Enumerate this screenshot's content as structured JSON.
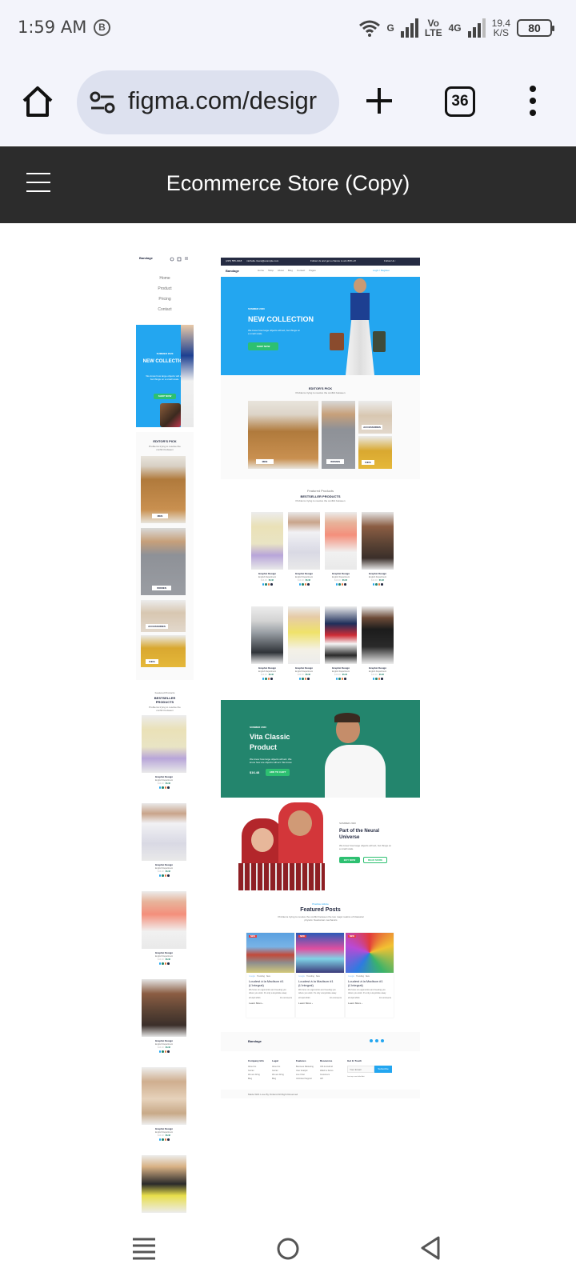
{
  "status": {
    "time": "1:59 AM",
    "b_icon": "B",
    "g_label": "G",
    "volte_top": "Vo",
    "volte_bottom": "LTE",
    "net_4g": "4G",
    "speed_value": "19.4",
    "speed_unit": "K/S",
    "battery": "80"
  },
  "browser": {
    "url": "figma.com/desigr",
    "tab_count": "36"
  },
  "figma": {
    "title": "Ecommerce Store (Copy)"
  },
  "mobile_frame": {
    "brand": "Bandage",
    "nav": [
      "Home",
      "Product",
      "Pricing",
      "Contact"
    ],
    "hero_tag": "SUMMER 2020",
    "hero_title": "NEW COLLECTION",
    "hero_text": "We know how large objects will act, but things on a small scale.",
    "hero_button": "SHOP NOW",
    "editors_pick": "EDITOR'S PICK",
    "editors_sub": "Problems trying to resolve the conflict between",
    "pick_labels": [
      "MEN",
      "WOMEN",
      "ACCESSORIES",
      "KIDS"
    ],
    "featured_label": "Featured Products",
    "bestseller": "BESTSELLER PRODUCTS",
    "bestseller_sub": "Problems trying to resolve the conflict between",
    "product_title": "Graphic Design",
    "product_dept": "English Department",
    "price_old": "$16.48",
    "price_new": "$6.48"
  },
  "desktop_frame": {
    "topbar_phone": "(225) 555-0118",
    "topbar_email": "michelle.rivera@example.com",
    "topbar_promo": "Follow Us and get a chance to win 80% off",
    "topbar_follow": "Follow Us :",
    "brand": "Bandage",
    "nav": [
      "Home",
      "Shop",
      "About",
      "Blog",
      "Contact",
      "Pages"
    ],
    "login": "Login / Register",
    "hero_tag": "SUMMER 2020",
    "hero_title": "NEW COLLECTION",
    "hero_text": "We know how large objects will act, but things on a small scale.",
    "hero_button": "SHOP NOW",
    "editors_pick": "EDITOR'S PICK",
    "editors_sub": "Problems trying to resolve the conflict between",
    "pick_labels": [
      "MEN",
      "WOMEN",
      "ACCESSORIES",
      "KIDS"
    ],
    "featured_label": "Featured Products",
    "bestseller": "BESTSELLER PRODUCTS",
    "bestseller_sub": "Problems trying to resolve the conflict between",
    "product_title": "Graphic Design",
    "product_dept": "English Department",
    "price_old": "$16.48",
    "price_new": "$6.48",
    "vita_tag": "SUMMER 2020",
    "vita_title": "Vita Classic Product",
    "vita_text": "We know how large objects will act. We know how are objects will act. We know",
    "vita_price": "$16.48",
    "vita_button": "ADD TO CART",
    "neural_tag": "SUMMER 2020",
    "neural_title": "Part of the Neural Universe",
    "neural_text": "We know how large objects will act, but things on a small scale.",
    "neural_buy": "BUY NOW",
    "neural_read": "READ MORE",
    "posts_tag": "Practice Advice",
    "posts_title": "Featured Posts",
    "posts_sub": "Problems trying to resolve the conflict between the two major realms of Classical physics: Newtonian mechanics",
    "post_badge": "NEW",
    "post_tags": [
      "Google",
      "Trending",
      "New"
    ],
    "post_title": "Loudest à la Madison #1 (L'integral)",
    "post_text": "We focus on ergonomics and meeting you where you work. It's only a keystroke away.",
    "post_date": "22 April 2021",
    "post_comments": "10 comments",
    "post_learn": "Learn More",
    "footer_brand": "Bandage",
    "footer_cols": [
      {
        "title": "Company Info",
        "items": [
          "About Us",
          "Carrier",
          "We are hiring",
          "Blog"
        ]
      },
      {
        "title": "Legal",
        "items": [
          "About Us",
          "Carrier",
          "We are hiring",
          "Blog"
        ]
      },
      {
        "title": "Features",
        "items": [
          "Business Marketing",
          "User Analytic",
          "Live Chat",
          "Unlimited Support"
        ]
      },
      {
        "title": "Resources",
        "items": [
          "IOS & Android",
          "Watch a Demo",
          "Customers",
          "API"
        ]
      }
    ],
    "footer_touch": "Get In Touch",
    "footer_email_placeholder": "Your Email",
    "footer_subscribe": "Subscribe",
    "footer_note": "Lore imp sum dolor Amit",
    "footer_copy": "Made With Love By Finland All Right Reserved"
  },
  "colors": {
    "hero_blue": "#23a6f0",
    "vita_green": "#23856d",
    "cta_green": "#2dc071",
    "dark_header": "#2c2c2c",
    "status_bg": "#f3f4fb"
  },
  "icons": {
    "home": "home-icon",
    "tune": "site-settings-icon",
    "plus": "new-tab-icon",
    "more": "more-vert-icon",
    "hamburger": "menu-icon",
    "nav_recents": "recents-icon",
    "nav_home": "home-circle-icon",
    "nav_back": "back-triangle-icon"
  }
}
